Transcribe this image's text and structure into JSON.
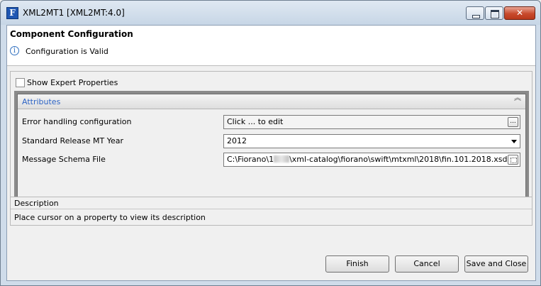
{
  "window": {
    "title": "XML2MT1 [XML2MT:4.0]",
    "app_icon_letter": "F"
  },
  "header": {
    "title": "Component Configuration",
    "status": "Configuration is Valid"
  },
  "options": {
    "show_expert_label": "Show Expert Properties",
    "show_expert_checked": false
  },
  "attributes": {
    "section_title": "Attributes",
    "properties": [
      {
        "label": "Error handling configuration",
        "value": "Click ... to edit",
        "editor": "ellipsis-button"
      },
      {
        "label": "Standard Release MT Year",
        "value": "2012",
        "editor": "dropdown"
      },
      {
        "label": "Message Schema File",
        "value_prefix": "C:\\Fiorano\\1",
        "value_suffix": "\\xml-catalog\\fiorano\\swift\\mtxml\\2018\\fin.101.2018.xsd",
        "editor": "file-chooser"
      }
    ]
  },
  "description": {
    "title": "Description",
    "text": "Place cursor on a property to view its description"
  },
  "buttons": {
    "finish": "Finish",
    "cancel": "Cancel",
    "save_close": "Save and Close"
  }
}
